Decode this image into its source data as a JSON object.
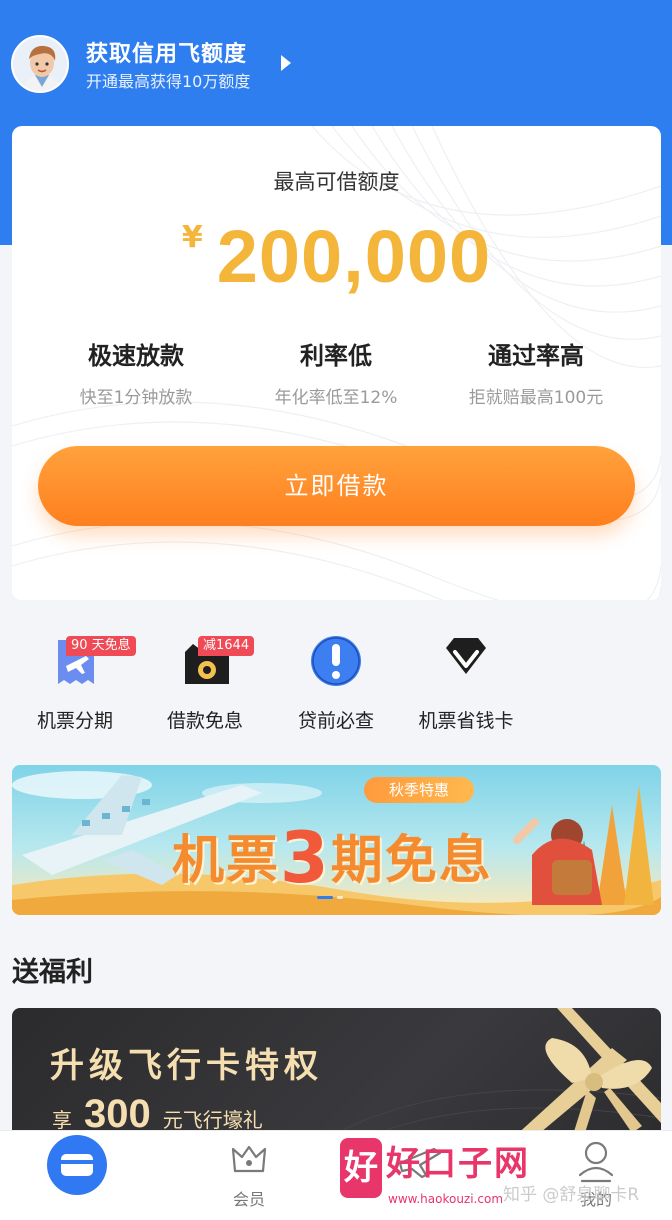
{
  "header": {
    "title": "获取信用飞额度",
    "subtitle": "开通最高获得10万额度"
  },
  "credit": {
    "label": "最高可借额度",
    "currency": "¥",
    "amount": "200,000"
  },
  "features": [
    {
      "title": "极速放款",
      "sub": "快至1分钟放款"
    },
    {
      "title": "利率低",
      "sub": "年化率低至12%"
    },
    {
      "title": "通过率高",
      "sub": "拒就赔最高100元"
    }
  ],
  "cta": {
    "label": "立即借款"
  },
  "quick_links": [
    {
      "label": "机票分期",
      "badge": "90 天免息",
      "icon": "ticket-plane-icon"
    },
    {
      "label": "借款免息",
      "badge": "减1644",
      "icon": "wallet-coin-icon"
    },
    {
      "label": "贷前必查",
      "badge": "",
      "icon": "exclamation-circle-icon"
    },
    {
      "label": "机票省钱卡",
      "badge": "",
      "icon": "diamond-check-icon"
    }
  ],
  "banner": {
    "tag": "秋季特惠",
    "text_before": "机票",
    "text_num": "3",
    "text_after": "期免息"
  },
  "section": {
    "title": "送福利"
  },
  "promo": {
    "title": "升级飞行卡特权",
    "prefix": "享",
    "amount": "300",
    "suffix": "元飞行壕礼"
  },
  "tabbar": {
    "tabs": [
      {
        "label": "",
        "icon": "card-icon",
        "active": true
      },
      {
        "label": "会员",
        "icon": "crown-icon",
        "active": false
      },
      {
        "label": "",
        "icon": "plane-icon",
        "active": false
      },
      {
        "label": "我的",
        "icon": "user-icon",
        "active": false
      }
    ]
  },
  "watermark": {
    "logo": "好",
    "name": "好口子网",
    "url": "www.haokouzi.com",
    "zhihu": "知乎 @舒泉聊卡R"
  },
  "colors": {
    "brand_blue": "#2f7ef0",
    "amount_gold": "#f4b63a",
    "cta_orange": "#ff8a28",
    "badge_red": "#ef4a55"
  }
}
